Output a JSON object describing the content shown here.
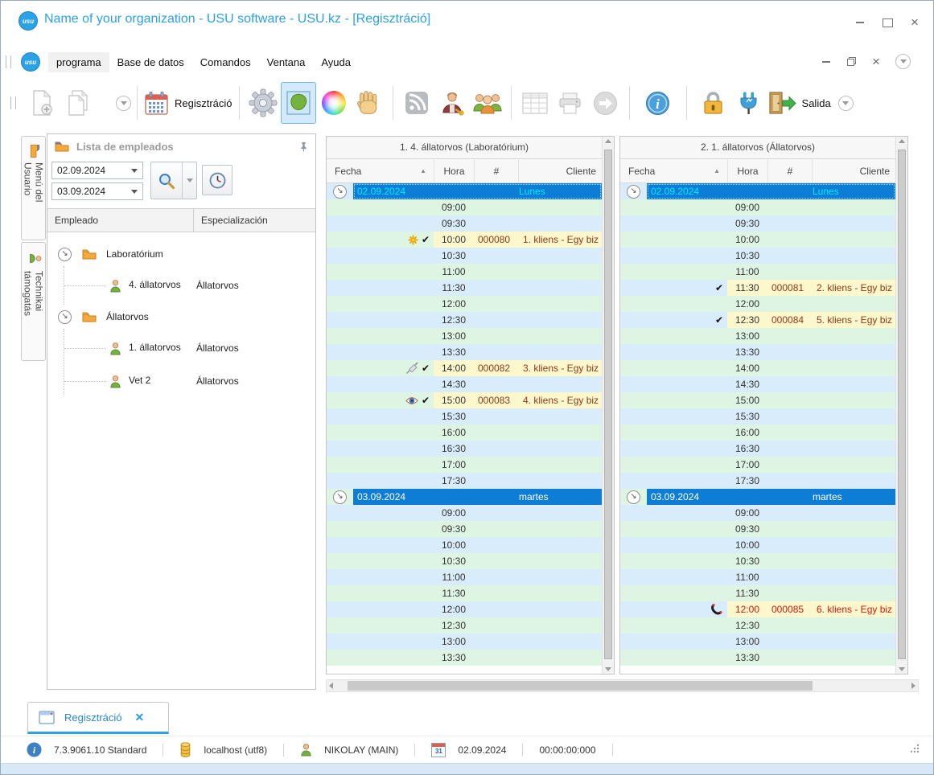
{
  "window": {
    "title": "Name of your organization - USU software - USU.kz - [Regisztráció]",
    "logo_text": "usu"
  },
  "menu": {
    "items": [
      "programa",
      "Base de datos",
      "Comandos",
      "Ventana",
      "Ayuda"
    ]
  },
  "toolbar": {
    "registration_label": "Regisztráció",
    "salida_label": "Salida"
  },
  "sidebar": {
    "tabs": [
      {
        "label": "Menú del Usuario",
        "icon": "folder-icon"
      },
      {
        "label": "Technikai támogatás",
        "icon": "person-icon"
      }
    ]
  },
  "employee_panel": {
    "title": "Lista de empleados",
    "date_from": "02.09.2024",
    "date_to": "03.09.2024",
    "columns": [
      "Empleado",
      "Especialización"
    ],
    "tree": [
      {
        "type": "folder",
        "label": "Laboratórium"
      },
      {
        "type": "person",
        "name": "4. állatorvos",
        "spec": "Állatorvos"
      },
      {
        "type": "folder",
        "label": "Állatorvos"
      },
      {
        "type": "person",
        "name": "1. állatorvos",
        "spec": "Állatorvos"
      },
      {
        "type": "person",
        "name": "Vet 2",
        "spec": "Állatorvos"
      }
    ]
  },
  "schedule": {
    "columns": [
      "Fecha",
      "Hora",
      "#",
      "Cliente"
    ],
    "panels": [
      {
        "title": "1. 4. állatorvos (Laboratórium)",
        "rows": [
          {
            "t": "g",
            "date": "02.09.2024",
            "day": "Lunes",
            "sel": true
          },
          {
            "t": "r",
            "time": "09:00"
          },
          {
            "t": "r",
            "time": "09:30"
          },
          {
            "t": "a",
            "time": "10:00",
            "num": "000080",
            "client": "1. kliens - Egy biz",
            "icons": [
              "star",
              "check"
            ]
          },
          {
            "t": "r",
            "time": "10:30"
          },
          {
            "t": "r",
            "time": "11:00"
          },
          {
            "t": "r",
            "time": "11:30"
          },
          {
            "t": "r",
            "time": "12:00"
          },
          {
            "t": "r",
            "time": "12:30"
          },
          {
            "t": "r",
            "time": "13:00"
          },
          {
            "t": "r",
            "time": "13:30"
          },
          {
            "t": "a",
            "time": "14:00",
            "num": "000082",
            "client": "3. kliens - Egy biz",
            "icons": [
              "syringe",
              "check"
            ]
          },
          {
            "t": "r",
            "time": "14:30"
          },
          {
            "t": "a",
            "time": "15:00",
            "num": "000083",
            "client": "4. kliens - Egy biz",
            "icons": [
              "eye",
              "check"
            ]
          },
          {
            "t": "r",
            "time": "15:30"
          },
          {
            "t": "r",
            "time": "16:00"
          },
          {
            "t": "r",
            "time": "16:30"
          },
          {
            "t": "r",
            "time": "17:00"
          },
          {
            "t": "r",
            "time": "17:30"
          },
          {
            "t": "g",
            "date": "03.09.2024",
            "day": "martes",
            "sel": false
          },
          {
            "t": "r",
            "time": "09:00"
          },
          {
            "t": "r",
            "time": "09:30"
          },
          {
            "t": "r",
            "time": "10:00"
          },
          {
            "t": "r",
            "time": "10:30"
          },
          {
            "t": "r",
            "time": "11:00"
          },
          {
            "t": "r",
            "time": "11:30"
          },
          {
            "t": "r",
            "time": "12:00"
          },
          {
            "t": "r",
            "time": "12:30"
          },
          {
            "t": "r",
            "time": "13:00"
          },
          {
            "t": "r",
            "time": "13:30"
          }
        ]
      },
      {
        "title": "2. 1. állatorvos (Állatorvos)",
        "rows": [
          {
            "t": "g",
            "date": "02.09.2024",
            "day": "Lunes",
            "sel": true
          },
          {
            "t": "r",
            "time": "09:00"
          },
          {
            "t": "r",
            "time": "09:30"
          },
          {
            "t": "r",
            "time": "10:00"
          },
          {
            "t": "r",
            "time": "10:30"
          },
          {
            "t": "r",
            "time": "11:00"
          },
          {
            "t": "a",
            "time": "11:30",
            "num": "000081",
            "client": "2. kliens - Egy biz",
            "icons": [
              "check"
            ]
          },
          {
            "t": "r",
            "time": "12:00"
          },
          {
            "t": "a",
            "time": "12:30",
            "num": "000084",
            "client": "5. kliens - Egy biz",
            "icons": [
              "check"
            ]
          },
          {
            "t": "r",
            "time": "13:00"
          },
          {
            "t": "r",
            "time": "13:30"
          },
          {
            "t": "r",
            "time": "14:00"
          },
          {
            "t": "r",
            "time": "14:30"
          },
          {
            "t": "r",
            "time": "15:00"
          },
          {
            "t": "r",
            "time": "15:30"
          },
          {
            "t": "r",
            "time": "16:00"
          },
          {
            "t": "r",
            "time": "16:30"
          },
          {
            "t": "r",
            "time": "17:00"
          },
          {
            "t": "r",
            "time": "17:30"
          },
          {
            "t": "g",
            "date": "03.09.2024",
            "day": "martes",
            "sel": false
          },
          {
            "t": "r",
            "time": "09:00"
          },
          {
            "t": "r",
            "time": "09:30"
          },
          {
            "t": "r",
            "time": "10:00"
          },
          {
            "t": "r",
            "time": "10:30"
          },
          {
            "t": "r",
            "time": "11:00"
          },
          {
            "t": "r",
            "time": "11:30"
          },
          {
            "t": "a",
            "time": "12:00",
            "num": "000085",
            "client": "6. kliens - Egy biz",
            "icons": [
              "phone"
            ],
            "red": true
          },
          {
            "t": "r",
            "time": "12:30"
          },
          {
            "t": "r",
            "time": "13:00"
          },
          {
            "t": "r",
            "time": "13:30"
          }
        ]
      }
    ]
  },
  "bottom_tabs": {
    "active_tab": "Regisztráció"
  },
  "status_bar": {
    "version": "7.3.9061.10 Standard",
    "database": "localhost (utf8)",
    "user": "NIKOLAY (MAIN)",
    "date": "02.09.2024",
    "timer": "00:00:00:000",
    "calendar_day": "31"
  },
  "icons": {
    "expand": "↘",
    "check": "✔",
    "sort": "▲"
  },
  "colors": {
    "accent_blue": "#2ba1e8",
    "group_row_blue": "#0d7dd6",
    "group_selected_text": "#00eaff",
    "row_stripe_blue": "#d9ecfb",
    "row_stripe_green": "#def5e3",
    "appointment_yellow": "#fcf7cc",
    "appointment_text": "#8c3a1a",
    "appointment_alert_red": "#cf1a0f"
  }
}
